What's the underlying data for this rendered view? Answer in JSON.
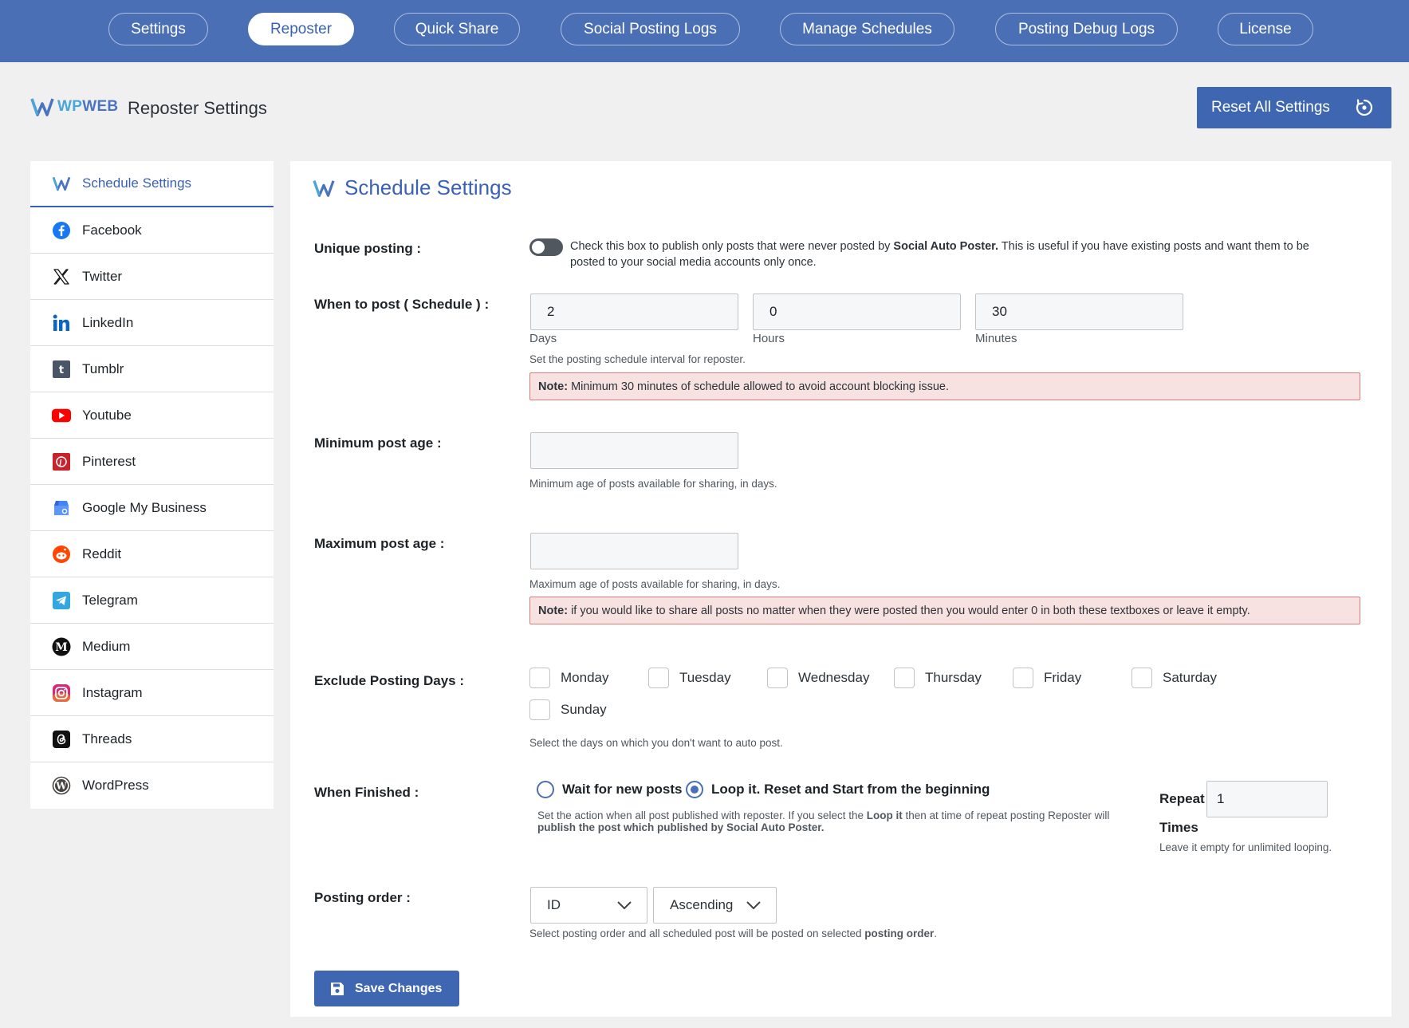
{
  "nav": {
    "tabs": [
      {
        "label": "Settings"
      },
      {
        "label": "Reposter",
        "active": true
      },
      {
        "label": "Quick Share"
      },
      {
        "label": "Social Posting Logs"
      },
      {
        "label": "Manage Schedules"
      },
      {
        "label": "Posting Debug Logs"
      },
      {
        "label": "License"
      }
    ]
  },
  "header": {
    "logo_wp": "WP",
    "logo_web": "WEB",
    "title": "Reposter Settings",
    "reset_label": "Reset All Settings"
  },
  "sidebar": {
    "items": [
      {
        "label": "Schedule Settings",
        "icon": "wpweb-icon",
        "active": true
      },
      {
        "label": "Facebook",
        "icon": "facebook-icon"
      },
      {
        "label": "Twitter",
        "icon": "x-twitter-icon"
      },
      {
        "label": "LinkedIn",
        "icon": "linkedin-icon"
      },
      {
        "label": "Tumblr",
        "icon": "tumblr-icon"
      },
      {
        "label": "Youtube",
        "icon": "youtube-icon"
      },
      {
        "label": "Pinterest",
        "icon": "pinterest-icon"
      },
      {
        "label": "Google My Business",
        "icon": "google-my-business-icon"
      },
      {
        "label": "Reddit",
        "icon": "reddit-icon"
      },
      {
        "label": "Telegram",
        "icon": "telegram-icon"
      },
      {
        "label": "Medium",
        "icon": "medium-icon"
      },
      {
        "label": "Instagram",
        "icon": "instagram-icon"
      },
      {
        "label": "Threads",
        "icon": "threads-icon"
      },
      {
        "label": "WordPress",
        "icon": "wordpress-icon"
      }
    ]
  },
  "panel": {
    "title": "Schedule Settings",
    "unique": {
      "label": "Unique posting :",
      "desc_pre": "Check this box to publish only posts that were never posted by ",
      "desc_bold": "Social Auto Poster.",
      "desc_post": " This is useful if you have existing posts and want them to be posted to your social media accounts only once."
    },
    "schedule": {
      "label": "When to post ( Schedule ) :",
      "days_value": "2",
      "days_label": "Days",
      "hours_value": "0",
      "hours_label": "Hours",
      "minutes_value": "30",
      "minutes_label": "Minutes",
      "help": "Set the posting schedule interval for reposter.",
      "note_bold": "Note:",
      "note_text": "Minimum 30 minutes of schedule allowed to avoid account blocking issue."
    },
    "min_age": {
      "label": "Minimum post age :",
      "value": "",
      "help": "Minimum age of posts available for sharing, in days."
    },
    "max_age": {
      "label": "Maximum post age :",
      "value": "",
      "help": "Maximum age of posts available for sharing, in days.",
      "note_bold": "Note:",
      "note_text": "if you would like to share all posts no matter when they were posted then you would enter 0 in both these textboxes or leave it empty."
    },
    "exclude": {
      "label": "Exclude Posting Days :",
      "days": [
        "Monday",
        "Tuesday",
        "Wednesday",
        "Thursday",
        "Friday",
        "Saturday",
        "Sunday"
      ],
      "help": "Select the days on which you don't want to auto post."
    },
    "finished": {
      "label": "When Finished :",
      "option_wait": "Wait for new posts",
      "option_loop": "Loop it. Reset and Start from the beginning",
      "selected": "loop",
      "help_pre": "Set the action when all post published with reposter. If you select the ",
      "help_bold1": "Loop it",
      "help_mid": " then at time of repeat posting Reposter will ",
      "help_bold2": "publish the post which published by Social Auto Poster.",
      "repeat_label": "Repeat",
      "repeat_value": "1",
      "times_label": "Times",
      "repeat_help": "Leave it empty for unlimited looping."
    },
    "order": {
      "label": "Posting order :",
      "field_value": "ID",
      "direction_value": "Ascending",
      "help_pre": "Select posting order and all scheduled post will be posted on selected ",
      "help_bold": "posting order",
      "help_post": "."
    },
    "save_label": "Save Changes"
  }
}
